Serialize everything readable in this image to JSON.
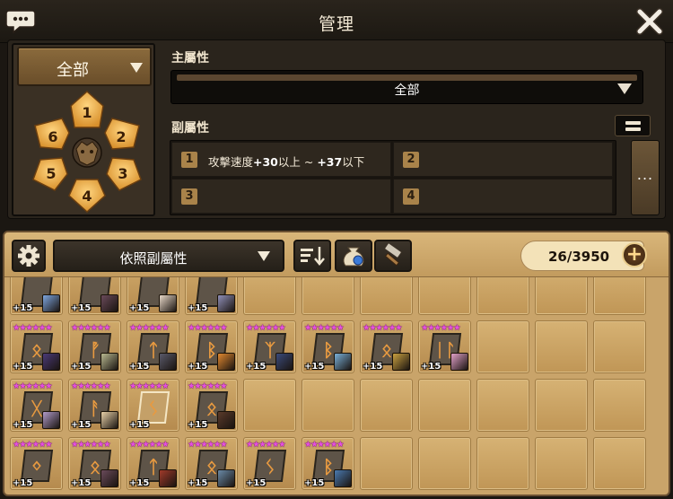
{
  "header": {
    "title": "管理"
  },
  "rune_set": {
    "selected": "全部"
  },
  "slots": [
    "1",
    "2",
    "3",
    "4",
    "5",
    "6"
  ],
  "main_stat": {
    "label": "主屬性",
    "selected": "全部"
  },
  "sub_stat": {
    "label": "副屬性",
    "filters": [
      {
        "num": "1",
        "stat": "攻擊速度",
        "min": "+30",
        "min_suffix": "以上 ~ ",
        "max": "+37",
        "max_suffix": "以下"
      },
      {
        "num": "2",
        "stat": "",
        "min": "",
        "min_suffix": "",
        "max": "",
        "max_suffix": ""
      },
      {
        "num": "3",
        "stat": "",
        "min": "",
        "min_suffix": "",
        "max": "",
        "max_suffix": ""
      },
      {
        "num": "4",
        "stat": "",
        "min": "",
        "min_suffix": "",
        "max": "",
        "max_suffix": ""
      }
    ],
    "more": "..."
  },
  "toolbar": {
    "sort_label": "依照副屬性",
    "count": "26/3950",
    "add_symbol": "+"
  },
  "colors": {
    "accent": "#c9a46a",
    "star": "#e64fe0",
    "panel_dark": "#2a241c"
  },
  "runes": [
    [
      {
        "lvl": "+15",
        "mon": "#7ea6e0"
      },
      {
        "lvl": "+15",
        "mon": "#6a4a5a"
      },
      {
        "lvl": "+15",
        "mon": "#e8d8c8"
      },
      {
        "lvl": "+15",
        "mon": "#9090b8"
      },
      null,
      null,
      null,
      null,
      null,
      null,
      null
    ],
    [
      {
        "stars": "★★★★★★",
        "lvl": "+15",
        "mon": "#4a3a78",
        "sym": "ᛟ"
      },
      {
        "stars": "★★★★★★",
        "lvl": "+15",
        "mon": "#b8b890",
        "sym": "ᚡ"
      },
      {
        "stars": "★★★★★★",
        "lvl": "+15",
        "mon": "#5a5a6a",
        "sym": "ᛏ"
      },
      {
        "stars": "★★★★★★",
        "lvl": "+15",
        "mon": "#e08830",
        "sym": "ᛒ"
      },
      {
        "stars": "★★★★★★",
        "lvl": "+15",
        "mon": "#3a4a7a",
        "sym": "ᛉ"
      },
      {
        "stars": "★★★★★★",
        "lvl": "+15",
        "mon": "#7ab0d8",
        "sym": "ᛒ"
      },
      {
        "stars": "★★★★★★",
        "lvl": "+15",
        "mon": "#c8a040",
        "sym": "ᛟ"
      },
      {
        "stars": "★★★★★★",
        "lvl": "+15",
        "mon": "#e0a0c8",
        "sym": "ᛁᛚ"
      },
      null,
      null,
      null
    ],
    [
      {
        "stars": "★★★★★★",
        "lvl": "+15",
        "mon": "#b09ac8",
        "sym": "ᚷ"
      },
      {
        "stars": "★★★★★★",
        "lvl": "+15",
        "mon": "#e8d0a8",
        "sym": "ᚨ"
      },
      {
        "stars": "★★★★★★",
        "lvl": "+15",
        "mon": "",
        "sym": "ᛊ",
        "highlight": true
      },
      {
        "stars": "★★★★★★",
        "lvl": "+15",
        "mon": "#5a3a2a",
        "sym": "ᛟ"
      },
      null,
      null,
      null,
      null,
      null,
      null,
      null
    ],
    [
      {
        "stars": "★★★★★★",
        "lvl": "+15",
        "mon": "",
        "sym": "ᛜ"
      },
      {
        "stars": "★★★★★★",
        "lvl": "+15",
        "mon": "#6a4a5a",
        "sym": "ᛟ"
      },
      {
        "stars": "★★★★★★",
        "lvl": "+15",
        "mon": "#a03a2a",
        "sym": "ᛏ"
      },
      {
        "stars": "★★★★★★",
        "lvl": "+15",
        "mon": "#6a8aa8",
        "sym": "ᛟ"
      },
      {
        "stars": "★★★★★★",
        "lvl": "+15",
        "mon": "",
        "sym": "ᛊ"
      },
      {
        "stars": "★★★★★★",
        "lvl": "+15",
        "mon": "#4a7ab0",
        "sym": "ᛒ"
      },
      null,
      null,
      null,
      null,
      null
    ]
  ]
}
